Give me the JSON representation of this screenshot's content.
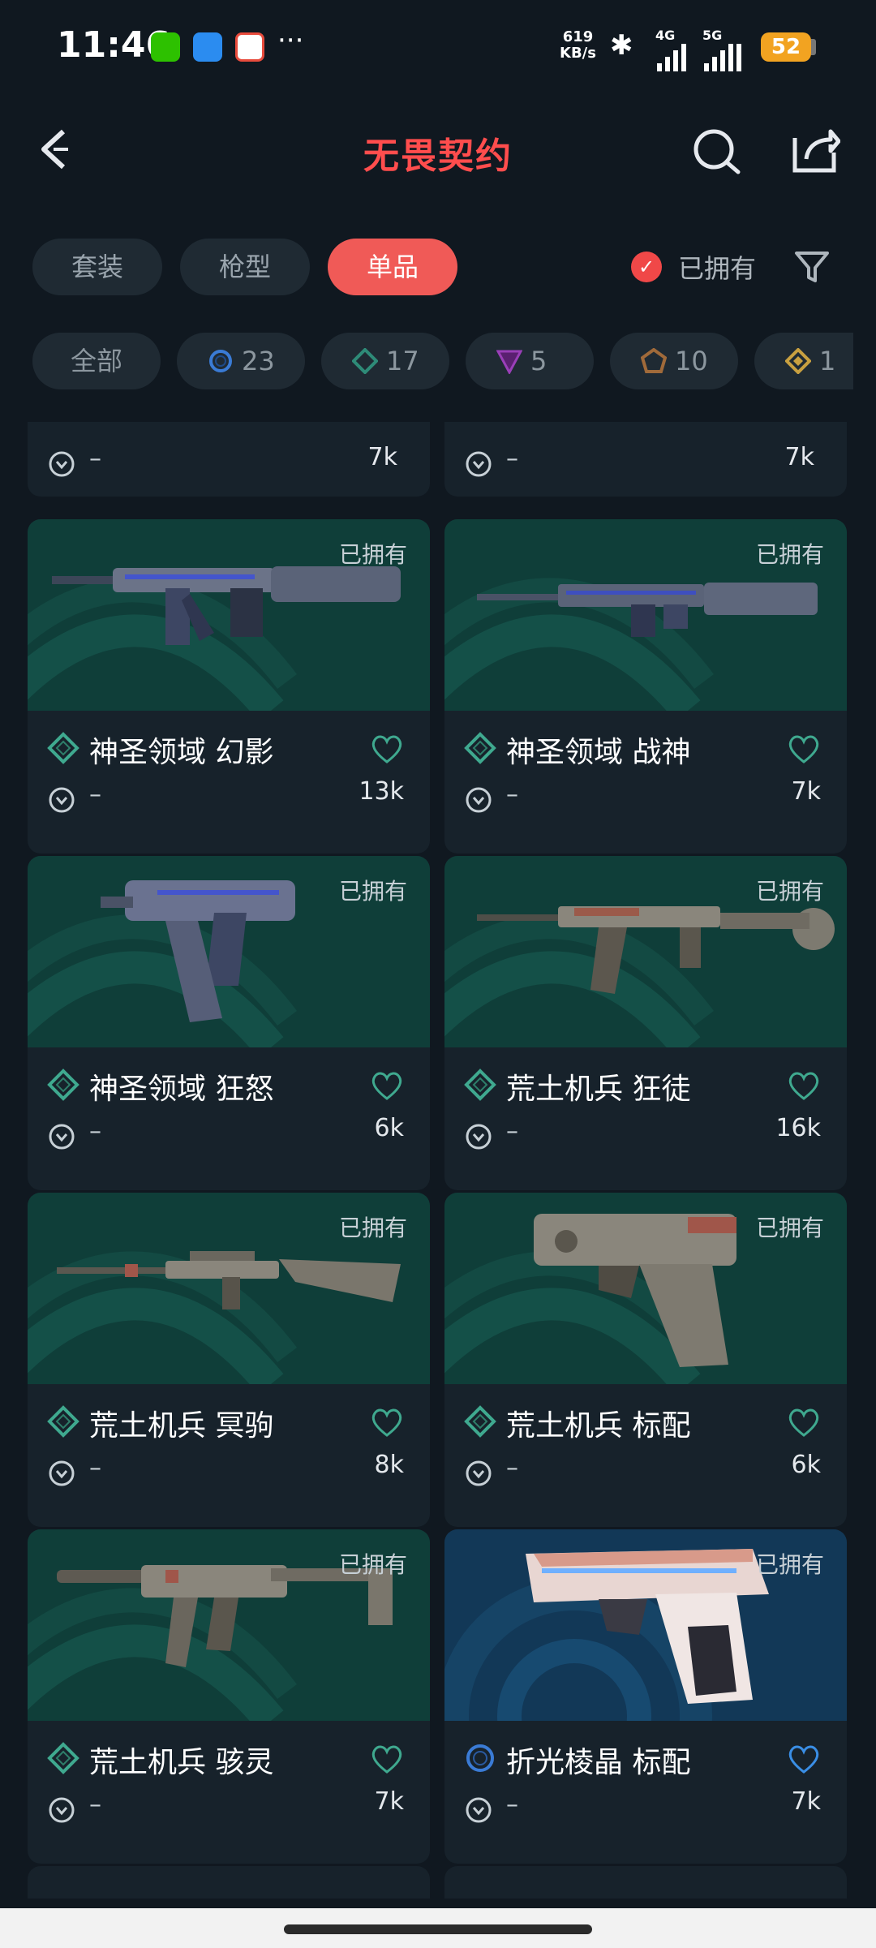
{
  "status_bar": {
    "time": "11:46",
    "net_speed_value": "619",
    "net_speed_unit": "KB/s",
    "signal1": "4G",
    "signal2": "5G",
    "battery": "52"
  },
  "header": {
    "title": "无畏契约"
  },
  "tabs": [
    {
      "label": "套装",
      "active": false
    },
    {
      "label": "枪型",
      "active": false
    },
    {
      "label": "单品",
      "active": true
    }
  ],
  "owned_filter": {
    "label": "已拥有",
    "checked": true
  },
  "rarity_chips": [
    {
      "label": "全部",
      "icon": "all",
      "color": ""
    },
    {
      "label": "23",
      "icon": "ring-icon",
      "color": "#3a7bd5"
    },
    {
      "label": "17",
      "icon": "diamond-icon",
      "color": "#2e8b78"
    },
    {
      "label": "5",
      "icon": "triangle-icon",
      "color": "#9a3fb8"
    },
    {
      "label": "10",
      "icon": "pentagon-icon",
      "color": "#a06a3a"
    },
    {
      "label": "1",
      "icon": "diamond-gold-icon",
      "color": "#c8a040"
    }
  ],
  "top_partial_cards": [
    {
      "name": "",
      "dash": "–",
      "count": "7k"
    },
    {
      "name": "",
      "dash": "–",
      "count": "7k"
    }
  ],
  "cards": [
    {
      "owned": "已拥有",
      "name": "神圣领域 幻影",
      "dash": "–",
      "count": "13k",
      "rarity": "diamond",
      "bg": "teal"
    },
    {
      "owned": "已拥有",
      "name": "神圣领域 战神",
      "dash": "–",
      "count": "7k",
      "rarity": "diamond",
      "bg": "teal"
    },
    {
      "owned": "已拥有",
      "name": "神圣领域 狂怒",
      "dash": "–",
      "count": "6k",
      "rarity": "diamond",
      "bg": "teal"
    },
    {
      "owned": "已拥有",
      "name": "荒土机兵 狂徒",
      "dash": "–",
      "count": "16k",
      "rarity": "diamond",
      "bg": "teal"
    },
    {
      "owned": "已拥有",
      "name": "荒土机兵 冥驹",
      "dash": "–",
      "count": "8k",
      "rarity": "diamond",
      "bg": "teal"
    },
    {
      "owned": "已拥有",
      "name": "荒土机兵 标配",
      "dash": "–",
      "count": "6k",
      "rarity": "diamond",
      "bg": "teal"
    },
    {
      "owned": "已拥有",
      "name": "荒土机兵 骇灵",
      "dash": "–",
      "count": "7k",
      "rarity": "diamond",
      "bg": "teal"
    },
    {
      "owned": "已拥有",
      "name": "折光棱晶 标配",
      "dash": "–",
      "count": "7k",
      "rarity": "ring",
      "bg": "blue"
    }
  ],
  "colors": {
    "accent": "#f05a57",
    "background": "#101820",
    "card": "#17222b",
    "art_teal": "#0f3e39",
    "art_blue": "#123857",
    "diamond": "#3fa98f",
    "ring": "#3a7bd5"
  }
}
